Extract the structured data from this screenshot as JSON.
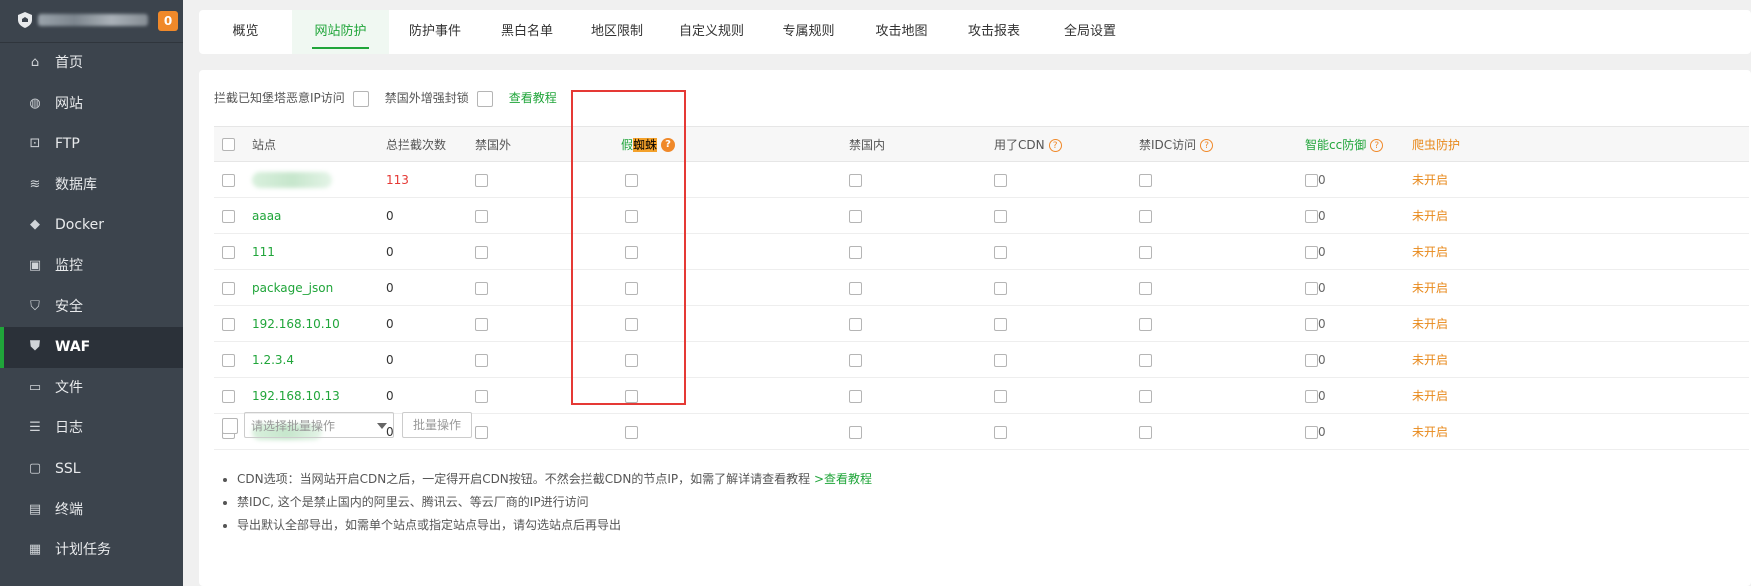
{
  "sidebar": {
    "badge": "0",
    "items": [
      {
        "label": "首页",
        "icon": "home-icon"
      },
      {
        "label": "网站",
        "icon": "globe-icon"
      },
      {
        "label": "FTP",
        "icon": "ftp-icon"
      },
      {
        "label": "数据库",
        "icon": "database-icon"
      },
      {
        "label": "Docker",
        "icon": "docker-icon"
      },
      {
        "label": "监控",
        "icon": "monitor-icon"
      },
      {
        "label": "安全",
        "icon": "shield-icon"
      },
      {
        "label": "WAF",
        "icon": "waf-icon",
        "active": true
      },
      {
        "label": "文件",
        "icon": "folder-icon"
      },
      {
        "label": "日志",
        "icon": "log-icon"
      },
      {
        "label": "SSL",
        "icon": "ssl-icon"
      },
      {
        "label": "终端",
        "icon": "terminal-icon"
      },
      {
        "label": "计划任务",
        "icon": "calendar-icon"
      }
    ]
  },
  "tabs": [
    "概览",
    "网站防护",
    "防护事件",
    "黑白名单",
    "地区限制",
    "自定义规则",
    "专属规则",
    "攻击地图",
    "攻击报表",
    "全局设置"
  ],
  "topbar": {
    "opt1": "拦截已知堡塔恶意IP访问",
    "opt2": "禁国外增强封锁",
    "tutorial": "查看教程"
  },
  "table": {
    "headers": {
      "site": "站点",
      "total": "总拦截次数",
      "ban_foreign": "禁国外",
      "spider_prefix": "假",
      "spider_hl": "蜘蛛",
      "ban_domestic": "禁国内",
      "cdn": "用了CDN",
      "idc": "禁IDC访问",
      "cc": "智能cc防御",
      "crawler": "爬虫防护"
    },
    "rows": [
      {
        "site": "",
        "total": "113",
        "cc": "0",
        "crawler": "未开启"
      },
      {
        "site": "aaaa",
        "total": "0",
        "cc": "0",
        "crawler": "未开启"
      },
      {
        "site": "111",
        "total": "0",
        "cc": "0",
        "crawler": "未开启"
      },
      {
        "site": "package_json",
        "total": "0",
        "cc": "0",
        "crawler": "未开启"
      },
      {
        "site": "192.168.10.10",
        "total": "0",
        "cc": "0",
        "crawler": "未开启"
      },
      {
        "site": "1.2.3.4",
        "total": "0",
        "cc": "0",
        "crawler": "未开启"
      },
      {
        "site": "192.168.10.13",
        "total": "0",
        "cc": "0",
        "crawler": "未开启"
      },
      {
        "site": "",
        "total": "0",
        "cc": "0",
        "crawler": "未开启"
      }
    ]
  },
  "batch": {
    "select_placeholder": "请选择批量操作",
    "button": "批量操作"
  },
  "notes": [
    {
      "text": "CDN选项：当网站开启CDN之后，一定得开启CDN按钮。不然会拦截CDN的节点IP，如需了解详请查看教程",
      "link": ">查看教程"
    },
    {
      "text": "禁IDC, 这个是禁止国内的阿里云、腾讯云、等云厂商的IP进行访问",
      "link": ""
    },
    {
      "text": "导出默认全部导出，如需单个站点或指定站点导出，请勾选站点后再导出",
      "link": ""
    }
  ],
  "colors": {
    "accent": "#20a53a",
    "highlight_box": "#e53935",
    "badge": "#f0892a"
  }
}
